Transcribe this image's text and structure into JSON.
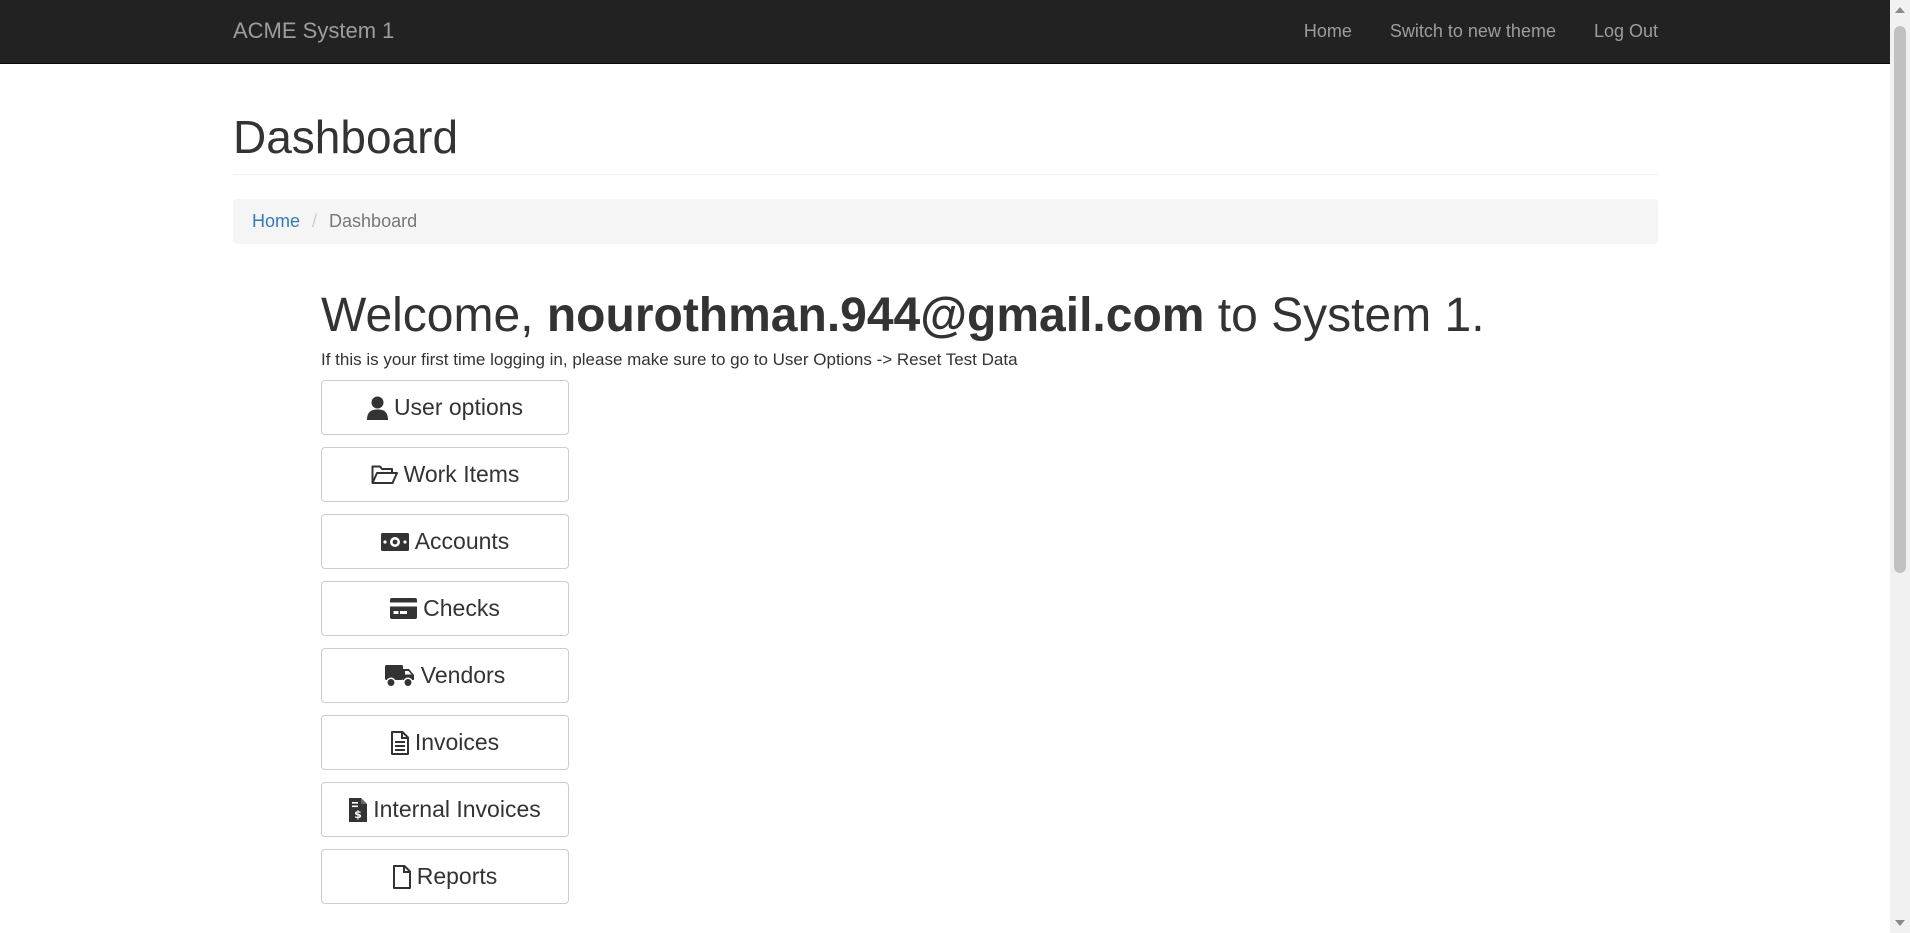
{
  "navbar": {
    "brand": "ACME System 1",
    "links": [
      {
        "label": "Home"
      },
      {
        "label": "Switch to new theme"
      },
      {
        "label": "Log Out"
      }
    ]
  },
  "page": {
    "title": "Dashboard"
  },
  "breadcrumb": {
    "home": "Home",
    "separator": "/",
    "current": "Dashboard"
  },
  "welcome": {
    "prefix": "Welcome,",
    "user": "nourothman.944@gmail.com",
    "suffix": "to System 1.",
    "notice": "If this is your first time logging in, please make sure to go to User Options -> Reset Test Data"
  },
  "menu_buttons": [
    {
      "label": "User options",
      "icon": "user-icon"
    },
    {
      "label": "Work Items",
      "icon": "folder-open-icon"
    },
    {
      "label": "Accounts",
      "icon": "money-bill-icon"
    },
    {
      "label": "Checks",
      "icon": "credit-card-icon"
    },
    {
      "label": "Vendors",
      "icon": "truck-icon"
    },
    {
      "label": "Invoices",
      "icon": "file-text-icon"
    },
    {
      "label": "Internal Invoices",
      "icon": "file-invoice-dollar-icon"
    },
    {
      "label": "Reports",
      "icon": "file-icon"
    }
  ],
  "colors": {
    "navbar_bg": "#222222",
    "nav_text": "#9d9d9d",
    "link": "#337ab7",
    "breadcrumb_bg": "#f5f5f5"
  }
}
